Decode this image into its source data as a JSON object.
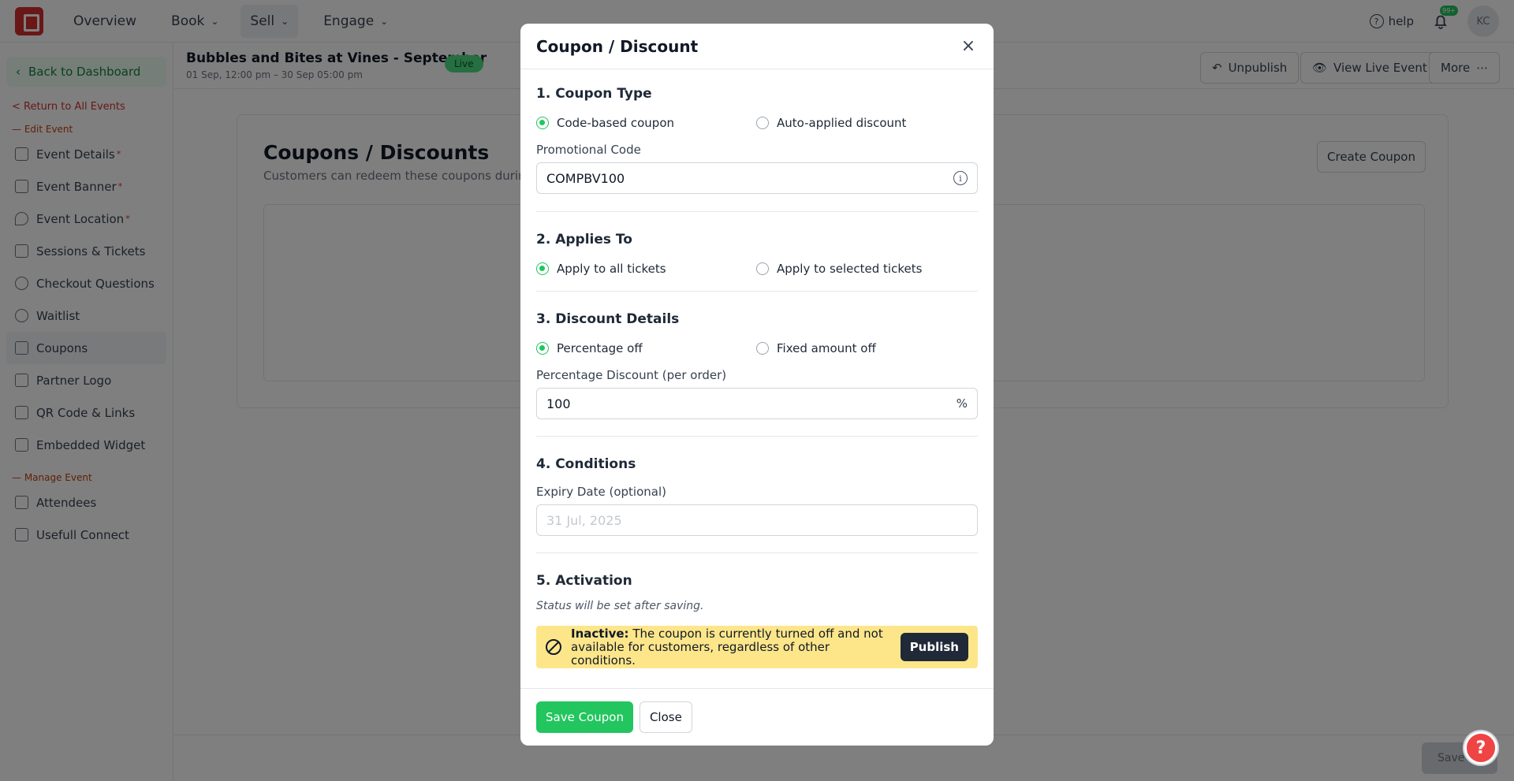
{
  "topnav": {
    "items": [
      {
        "label": "Overview",
        "has_chevron": false
      },
      {
        "label": "Book",
        "has_chevron": true
      },
      {
        "label": "Sell",
        "has_chevron": true,
        "active": true
      },
      {
        "label": "Engage",
        "has_chevron": true
      }
    ],
    "help_label": "help",
    "notification_count": "99+",
    "avatar_initials": "KC"
  },
  "sidebar": {
    "back_label": "Back to Dashboard",
    "return_label": "< Return to All Events",
    "edit_section": "— Edit Event",
    "edit_items": [
      {
        "label": "Event Details",
        "required": true,
        "icon": "list-icon"
      },
      {
        "label": "Event Banner",
        "required": true,
        "icon": "image-icon"
      },
      {
        "label": "Event Location",
        "required": true,
        "icon": "map-pin-icon"
      },
      {
        "label": "Sessions & Tickets",
        "required": false,
        "icon": "ticket-icon"
      },
      {
        "label": "Checkout Questions",
        "required": false,
        "icon": "question-icon"
      },
      {
        "label": "Waitlist",
        "required": false,
        "icon": "clock-icon"
      },
      {
        "label": "Coupons",
        "required": false,
        "icon": "scissors-icon",
        "active": true
      },
      {
        "label": "Partner Logo",
        "required": false,
        "icon": "link-icon"
      },
      {
        "label": "QR Code & Links",
        "required": false,
        "icon": "qr-icon"
      },
      {
        "label": "Embedded Widget",
        "required": false,
        "icon": "code-icon"
      }
    ],
    "manage_section": "— Manage Event",
    "manage_items": [
      {
        "label": "Attendees",
        "icon": "users-icon"
      },
      {
        "label": "Usefull Connect",
        "icon": "phone-icon"
      }
    ]
  },
  "event": {
    "title": "Bubbles and Bites at Vines - September",
    "dates": "01 Sep, 12:00 pm – 30 Sep 05:00 pm",
    "status": "Live",
    "unpublish_label": "Unpublish",
    "view_live_label": "View Live Event",
    "more_label": "More"
  },
  "page": {
    "title": "Coupons / Discounts",
    "subtitle": "Customers can redeem these coupons during",
    "create_label": "Create Coupon",
    "save_label": "Save"
  },
  "modal": {
    "title": "Coupon / Discount",
    "section1": {
      "title": "1. Coupon Type",
      "options": [
        "Code-based coupon",
        "Auto-applied discount"
      ],
      "selected": 0,
      "code_label": "Promotional Code",
      "code_value": "COMPBV100"
    },
    "section2": {
      "title": "2. Applies To",
      "options": [
        "Apply to all tickets",
        "Apply to selected tickets"
      ],
      "selected": 0
    },
    "section3": {
      "title": "3. Discount Details",
      "options": [
        "Percentage off",
        "Fixed amount off"
      ],
      "selected": 0,
      "pct_label": "Percentage Discount (per order)",
      "pct_value": "100",
      "pct_suffix": "%"
    },
    "section4": {
      "title": "4. Conditions",
      "expiry_label": "Expiry Date (optional)",
      "expiry_placeholder": "31 Jul, 2025"
    },
    "section5": {
      "title": "5. Activation",
      "status_note": "Status will be set after saving.",
      "inactive_bold": "Inactive:",
      "inactive_text": "The coupon is currently turned off and not available for customers, regardless of other conditions.",
      "publish_label": "Publish"
    },
    "save_label": "Save Coupon",
    "close_label": "Close"
  },
  "colors": {
    "accent_green": "#22c55e",
    "brand_red": "#d32f2f",
    "warning_yellow": "#fde68a"
  }
}
